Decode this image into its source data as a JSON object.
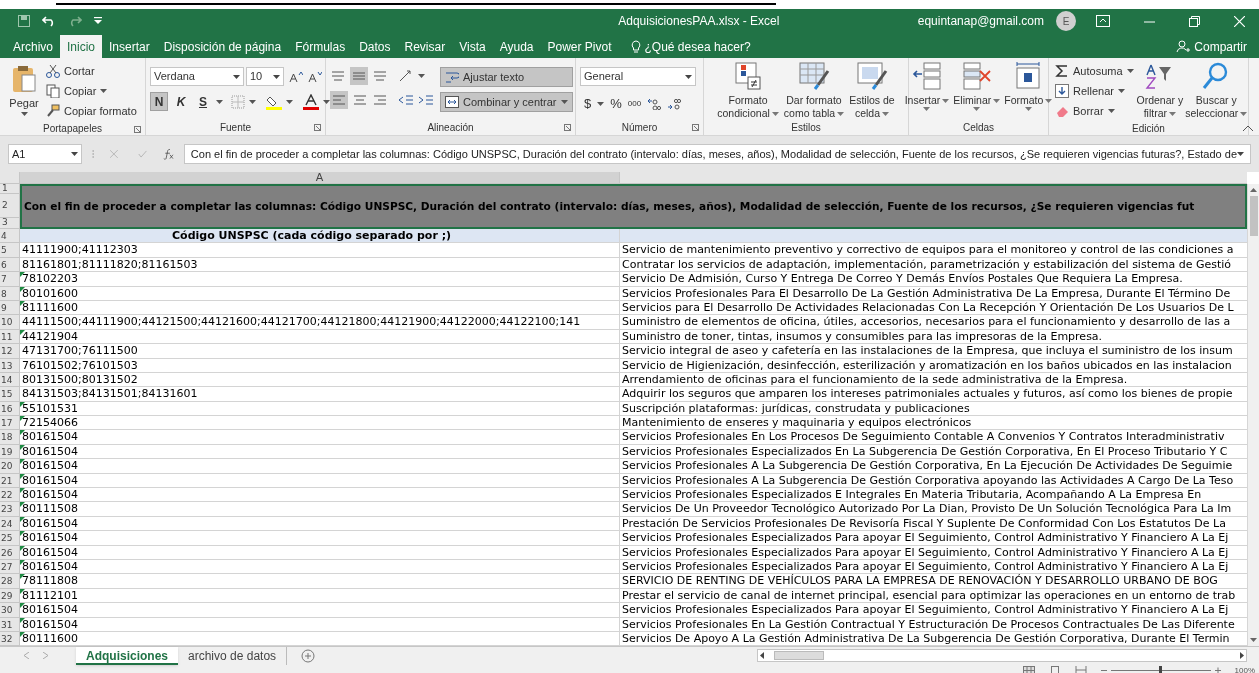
{
  "window": {
    "title": "AdquisicionesPAA.xlsx  -  Excel",
    "account": "equintanap@gmail.com",
    "avatar": "E"
  },
  "tabs": [
    {
      "label": "Archivo",
      "selected": false
    },
    {
      "label": "Inicio",
      "selected": true
    },
    {
      "label": "Insertar",
      "selected": false
    },
    {
      "label": "Disposición de página",
      "selected": false
    },
    {
      "label": "Fórmulas",
      "selected": false
    },
    {
      "label": "Datos",
      "selected": false
    },
    {
      "label": "Revisar",
      "selected": false
    },
    {
      "label": "Vista",
      "selected": false
    },
    {
      "label": "Ayuda",
      "selected": false
    },
    {
      "label": "Power Pivot",
      "selected": false
    }
  ],
  "tell_me": "¿Qué desea hacer?",
  "share": "Compartir",
  "ribbon": {
    "clipboard": {
      "label": "Portapapeles",
      "paste": "Pegar",
      "cut": "Cortar",
      "copy": "Copiar",
      "format_painter": "Copiar formato"
    },
    "font": {
      "label": "Fuente",
      "family": "Verdana",
      "size": "10",
      "bold": {
        "label": "N",
        "on": true
      },
      "italic": {
        "label": "K",
        "on": false
      },
      "underline": {
        "label": "S",
        "on": false
      }
    },
    "alignment": {
      "label": "Alineación",
      "wrap": {
        "label": "Ajustar texto",
        "on": true
      },
      "merge": {
        "label": "Combinar y centrar",
        "on": true
      }
    },
    "number": {
      "label": "Número",
      "format": "General",
      "currency": "$",
      "percent": "%",
      "thousands": "000"
    },
    "styles": {
      "label": "Estilos",
      "buttons": [
        {
          "lines": [
            "Formato",
            "condicional"
          ]
        },
        {
          "lines": [
            "Dar formato",
            "como tabla"
          ]
        },
        {
          "lines": [
            "Estilos de",
            "celda"
          ]
        }
      ]
    },
    "cells": {
      "label": "Celdas",
      "buttons": [
        {
          "label": "Insertar"
        },
        {
          "label": "Eliminar"
        },
        {
          "label": "Formato"
        }
      ]
    },
    "editing": {
      "label": "Edición",
      "autosum": "Autosuma",
      "fill": "Rellenar",
      "clear": "Borrar",
      "sort": [
        "Ordenar y",
        "filtrar"
      ],
      "find": [
        "Buscar y",
        "seleccionar"
      ]
    }
  },
  "formula_bar": {
    "name_box": "A1",
    "content": "Con el fin de proceder a completar las columnas: Código UNSPSC, Duración del contrato (intervalo: días, meses, años), Modalidad de selección, Fuente de los recursos, ¿Se requieren vigencias futuras?, Estado de"
  },
  "sheet": {
    "column_a": "A",
    "title_rows": [
      "1",
      "2",
      "3"
    ],
    "title": "Con el fin de proceder a completar las columnas: Código UNSPSC, Duración del contrato (intervalo: días, meses, años), Modalidad de selección, Fuente de los recursos, ¿Se requieren vigencias fut",
    "header_row": "4",
    "header": "Código UNSPSC (cada código separado por ;)",
    "rows": [
      {
        "row": "5",
        "code": "41111900;41112303",
        "flagged": false,
        "description": "Servicio de mantenimiento preventivo y correctivo de equipos para el monitoreo y control de las condiciones a"
      },
      {
        "row": "6",
        "code": "81161801;81111820;81161503",
        "flagged": false,
        "description": "Contratar los servicios de adaptación, implementación, parametrización y estabilización del sistema de Gestió"
      },
      {
        "row": "7",
        "code": "78102203",
        "flagged": true,
        "description": "Servicio De Admisión, Curso Y Entrega De Correo Y Demás Envíos Postales Que Requiera La Empresa."
      },
      {
        "row": "8",
        "code": "80101600",
        "flagged": true,
        "description": "Servicios Profesionales Para El Desarrollo De La Gestión Administrativa De La Empresa, Durante El Término De"
      },
      {
        "row": "9",
        "code": "81111600",
        "flagged": true,
        "description": "Servicios para El Desarrollo De Actividades Relacionadas Con La Recepción Y Orientación De Los Usuarios De L"
      },
      {
        "row": "10",
        "code": "44111500;44111900;44121500;44121600;44121700;44121800;44121900;44122000;44122100;141",
        "flagged": false,
        "description": "Suministro de elementos de oficina, útiles, accesorios, necesarios para el funcionamiento y desarrollo de las a"
      },
      {
        "row": "11",
        "code": "44121904",
        "flagged": true,
        "description": "Suministro de toner, tintas, insumos y consumibles para las impresoras de la Empresa."
      },
      {
        "row": "12",
        "code": "47131700;76111500",
        "flagged": false,
        "description": "Servicio integral de aseo y cafetería en las instalaciones de la Empresa, que incluya el suministro de los insum"
      },
      {
        "row": "13",
        "code": "76101502;76101503",
        "flagged": false,
        "description": "Servicio de Higienización, desinfección, esterilización y aromatización en los baños ubicados en las instalacion"
      },
      {
        "row": "14",
        "code": "80131500;80131502",
        "flagged": false,
        "description": "Arrendamiento de oficinas para el funcionamiento de la sede administrativa de la Empresa."
      },
      {
        "row": "15",
        "code": "84131503;84131501;84131601",
        "flagged": false,
        "description": "Adquirir los seguros que amparen los intereses patrimoniales actuales y futuros, así como los bienes de propie"
      },
      {
        "row": "16",
        "code": "55101531",
        "flagged": true,
        "description": "Suscripción plataformas: jurídicas, construdata y publicaciones"
      },
      {
        "row": "17",
        "code": "72154066",
        "flagged": true,
        "description": "Mantenimiento de enseres y maquinaria y equipos electrónicos"
      },
      {
        "row": "18",
        "code": "80161504",
        "flagged": true,
        "description": "Servicios Profesionales En Los Procesos De Seguimiento Contable A  Convenios Y Contratos Interadministrativ"
      },
      {
        "row": "19",
        "code": "80161504",
        "flagged": true,
        "description": "Servicios Profesionales Especializados En La Subgerencia De Gestión Corporativa, En El Proceso Tributario Y C"
      },
      {
        "row": "20",
        "code": "80161504",
        "flagged": true,
        "description": "Servicios Profesionales A La Subgerencia De Gestión Corporativa, En La Ejecución De Actividades De Seguimie"
      },
      {
        "row": "21",
        "code": "80161504",
        "flagged": true,
        "description": "Servicios Profesionales A La Subgerencia De Gestión Corporativa apoyando las Actividades A Cargo De La Teso"
      },
      {
        "row": "22",
        "code": "80161504",
        "flagged": true,
        "description": "Servicios  Profesionales  Especializados  E  Integrales  En  Materia  Tributaria,  Acompañando A La Empresa En"
      },
      {
        "row": "23",
        "code": "80111508",
        "flagged": true,
        "description": "Servicios De Un Proveedor Tecnológico Autorizado Por La Dian, Provisto De Un Solución Tecnológica Para La Im"
      },
      {
        "row": "24",
        "code": "80161504",
        "flagged": true,
        "description": "Prestación De Servicios Profesionales De Revisoría Fiscal Y Suplente De Conformidad Con Los Estatutos De La"
      },
      {
        "row": "25",
        "code": "80161504",
        "flagged": true,
        "description": "Servicios Profesionales Especializados Para apoyar El Seguimiento, Control Administrativo Y Financiero A La Ej"
      },
      {
        "row": "26",
        "code": "80161504",
        "flagged": true,
        "description": "Servicios Profesionales Especializados Para apoyar El Seguimiento, Control Administrativo Y Financiero A La Ej"
      },
      {
        "row": "27",
        "code": "80161504",
        "flagged": true,
        "description": "Servicios Profesionales Especializados Para apoyar El Seguimiento, Control Administrativo Y Financiero A La Ej"
      },
      {
        "row": "28",
        "code": "78111808",
        "flagged": true,
        "description": "SERVICIO DE RENTING DE VEHÍCULOS PARA LA EMPRESA DE RENOVACIÓN Y DESARROLLO URBANO DE BOG"
      },
      {
        "row": "29",
        "code": "81112101",
        "flagged": true,
        "description": "Prestar el servicio de canal de internet principal, esencial para optimizar las operaciones en un entorno de trab"
      },
      {
        "row": "30",
        "code": "80161504",
        "flagged": true,
        "description": "Servicios Profesionales Especializados Para apoyar El Seguimiento, Control Administrativo Y Financiero A La Ej"
      },
      {
        "row": "31",
        "code": "80161504",
        "flagged": true,
        "description": "Servicios Profesionales En La Gestión Contractual Y Estructuración De Procesos Contractuales De Las Diferente"
      },
      {
        "row": "32",
        "code": "80111600",
        "flagged": true,
        "description": "Servicios De Apoyo A La Gestión Administrativa De La Subgerencia De Gestión Corporativa, Durante El Termin"
      }
    ]
  },
  "sheet_tabs": [
    {
      "label": "Adquisiciones",
      "selected": true
    },
    {
      "label": "archivo de datos",
      "selected": false
    }
  ],
  "status_bar": {
    "zoom": "100%"
  }
}
